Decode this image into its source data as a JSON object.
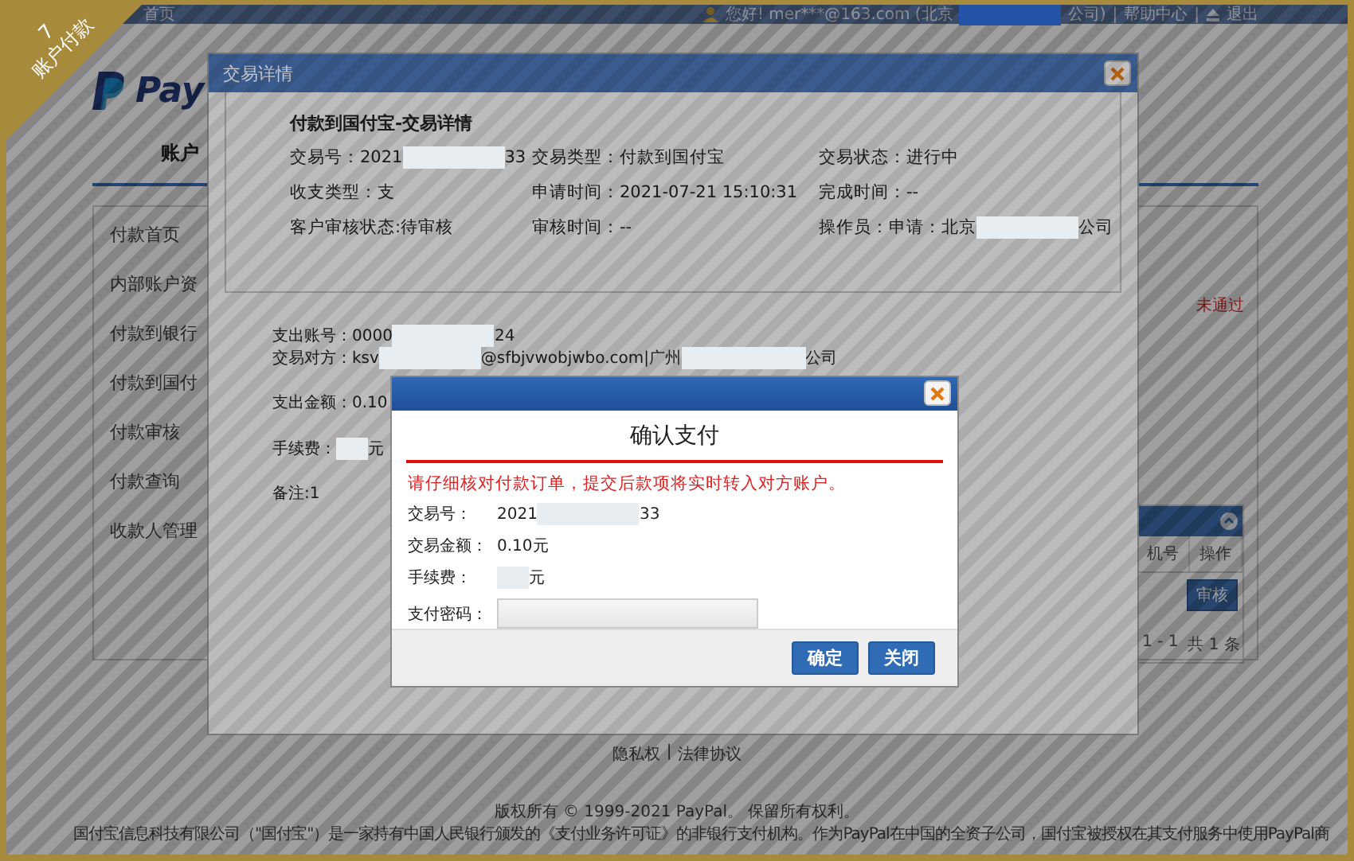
{
  "corner_ribbon": {
    "number": "7",
    "label": "账户付款"
  },
  "top_bar": {
    "home_link": "首页",
    "greeting": [
      {
        "kind": "text",
        "text": "您好! mer***@163.com (北京"
      },
      {
        "kind": "redacted_dark"
      },
      {
        "kind": "text",
        "text": "公司)"
      }
    ],
    "separator": "|",
    "help_link": "帮助中心",
    "logout_link": "退出"
  },
  "logo": {
    "text": "Pay"
  },
  "nav": [
    {
      "label": "账户",
      "selected": true
    }
  ],
  "sidebar": {
    "items": [
      {
        "label": "付款首页"
      },
      {
        "label": "内部账户资"
      },
      {
        "label": "付款到银行"
      },
      {
        "label": "付款到国付"
      },
      {
        "label": "付款审核"
      },
      {
        "label": "付款查询"
      },
      {
        "label": "收款人管理"
      }
    ]
  },
  "main": {
    "status_note": "未通过",
    "table": {
      "columns": [
        "机号",
        "操作"
      ],
      "rows": [
        {
          "action": "审核"
        }
      ],
      "range": "1 - 1",
      "total": "共 1 条"
    }
  },
  "footer": {
    "links": [
      "隐私权",
      "法律协议"
    ],
    "separator": "|",
    "copyright": "版权所有 © 1999-2021 PayPal。 保留所有权利。",
    "company": "国付宝信息科技有限公司（\"国付宝\"）是一家持有中国人民银行颁发的《支付业务许可证》的非银行支付机构。作为PayPal在中国的全资子公司，国付宝被授权在其支付服务中使用PayPal商"
  },
  "detail_dialog": {
    "title": "交易详情",
    "heading": "付款到国付宝-交易详情",
    "fields": [
      {
        "label": "交易号：",
        "segments": [
          {
            "kind": "text",
            "text": "2021"
          },
          {
            "kind": "redacted"
          },
          {
            "kind": "text",
            "text": "33"
          }
        ]
      },
      {
        "label": "交易类型：",
        "segments": [
          {
            "kind": "text",
            "text": "付款到国付宝"
          }
        ]
      },
      {
        "label": "交易状态：",
        "segments": [
          {
            "kind": "text",
            "text": "进行中"
          }
        ]
      },
      {
        "label": "收支类型：",
        "segments": [
          {
            "kind": "text",
            "text": "支"
          }
        ]
      },
      {
        "label": "申请时间：",
        "segments": [
          {
            "kind": "text",
            "text": "2021-07-21 15:10:31"
          }
        ]
      },
      {
        "label": "完成时间：",
        "segments": [
          {
            "kind": "text",
            "text": "--"
          }
        ]
      },
      {
        "label": "客户审核状态:",
        "segments": [
          {
            "kind": "text",
            "text": "待审核"
          }
        ]
      },
      {
        "label": "审核时间：",
        "segments": [
          {
            "kind": "text",
            "text": "--"
          }
        ]
      },
      {
        "label": "操作员：",
        "segments": [
          {
            "kind": "text",
            "text": "申请：北京"
          },
          {
            "kind": "redacted"
          },
          {
            "kind": "text",
            "text": "公司"
          }
        ]
      }
    ],
    "payment": [
      {
        "label": "支出账号：",
        "segments": [
          {
            "kind": "text",
            "text": "0000"
          },
          {
            "kind": "redacted"
          },
          {
            "kind": "text",
            "text": "24"
          }
        ]
      },
      {
        "label": "交易对方：",
        "segments": [
          {
            "kind": "text",
            "text": "ksv"
          },
          {
            "kind": "redacted"
          },
          {
            "kind": "text",
            "text": "@sfbjvwobjwbo.com|广州"
          },
          {
            "kind": "redacted_long"
          },
          {
            "kind": "text",
            "text": "公司"
          }
        ]
      },
      {
        "label": "支出金额：",
        "segments": [
          {
            "kind": "text",
            "text": "0.10"
          }
        ]
      },
      {
        "label": "手续费：",
        "segments": [
          {
            "kind": "redacted_short"
          },
          {
            "kind": "text",
            "text": "元"
          }
        ]
      },
      {
        "label": "备注:",
        "segments": [
          {
            "kind": "text",
            "text": "1"
          }
        ]
      }
    ]
  },
  "confirm_dialog": {
    "title": "确认支付",
    "warning": "请仔细核对付款订单，提交后款项将实时转入对方账户。",
    "fields": [
      {
        "label": "交易号：",
        "segments": [
          {
            "kind": "text",
            "text": "2021"
          },
          {
            "kind": "redacted"
          },
          {
            "kind": "text",
            "text": "33"
          }
        ]
      },
      {
        "label": "交易金额：",
        "segments": [
          {
            "kind": "text",
            "text": "0.10元"
          }
        ]
      },
      {
        "label": "手续费：",
        "segments": [
          {
            "kind": "redacted_short"
          },
          {
            "kind": "text",
            "text": "元"
          }
        ]
      }
    ],
    "password_label": "支付密码：",
    "buttons": [
      "确定",
      "关闭"
    ]
  }
}
